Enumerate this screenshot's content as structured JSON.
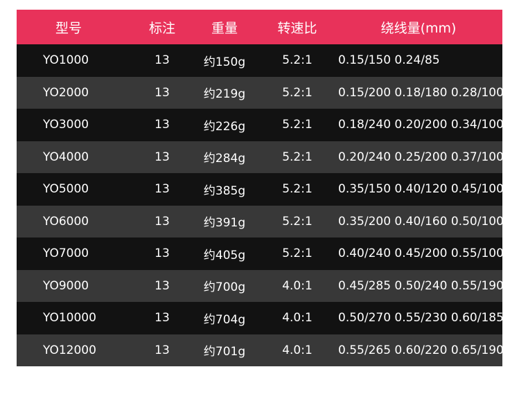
{
  "table": {
    "headers": {
      "model": "型号",
      "mark": "标注",
      "weight": "重量",
      "ratio": "转速比",
      "capacity": "绕线量(mm)"
    },
    "rows": [
      {
        "model": "YO1000",
        "mark": "13",
        "weight": "约150g",
        "ratio": "5.2:1",
        "capacity": "0.15/150  0.24/85"
      },
      {
        "model": "YO2000",
        "mark": "13",
        "weight": "约219g",
        "ratio": "5.2:1",
        "capacity": "0.15/200 0.18/180 0.28/100"
      },
      {
        "model": "YO3000",
        "mark": "13",
        "weight": "约226g",
        "ratio": "5.2:1",
        "capacity": "0.18/240 0.20/200 0.34/100"
      },
      {
        "model": "YO4000",
        "mark": "13",
        "weight": "约284g",
        "ratio": "5.2:1",
        "capacity": "0.20/240 0.25/200 0.37/100"
      },
      {
        "model": "YO5000",
        "mark": "13",
        "weight": "约385g",
        "ratio": "5.2:1",
        "capacity": "0.35/150 0.40/120 0.45/100"
      },
      {
        "model": "YO6000",
        "mark": "13",
        "weight": "约391g",
        "ratio": "5.2:1",
        "capacity": "0.35/200 0.40/160 0.50/100"
      },
      {
        "model": "YO7000",
        "mark": "13",
        "weight": "约405g",
        "ratio": "5.2:1",
        "capacity": "0.40/240 0.45/200 0.55/100"
      },
      {
        "model": "YO9000",
        "mark": "13",
        "weight": "约700g",
        "ratio": "4.0:1",
        "capacity": "0.45/285 0.50/240 0.55/190"
      },
      {
        "model": "YO10000",
        "mark": "13",
        "weight": "约704g",
        "ratio": "4.0:1",
        "capacity": "0.50/270 0.55/230 0.60/185"
      },
      {
        "model": "YO12000",
        "mark": "13",
        "weight": "约701g",
        "ratio": "4.0:1",
        "capacity": "0.55/265 0.60/220 0.65/190"
      }
    ]
  },
  "colors": {
    "header_bg": "#e8325a",
    "row_dark": "#121212",
    "row_light": "#383838",
    "text": "#ffffff"
  }
}
